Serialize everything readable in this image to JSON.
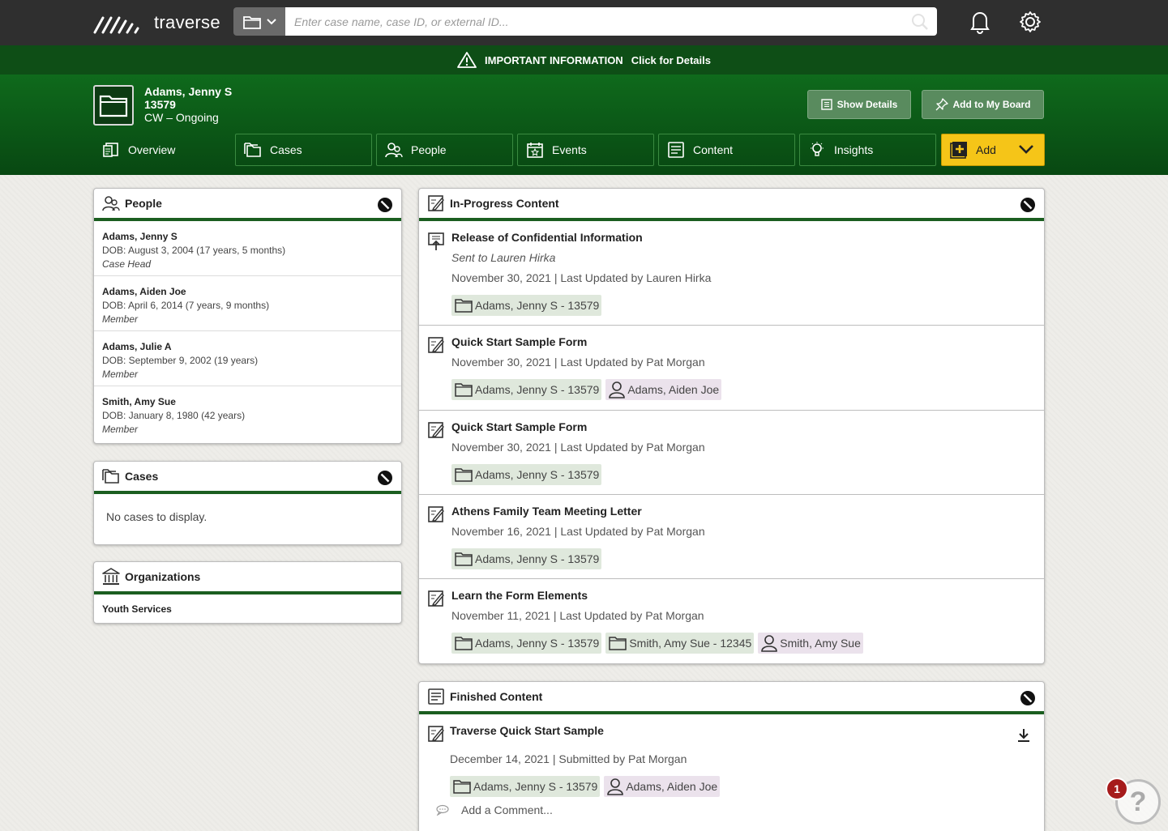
{
  "app": {
    "name": "traverse"
  },
  "search": {
    "placeholder": "Enter case name, case ID, or external ID..."
  },
  "infobar": {
    "title": "IMPORTANT INFORMATION",
    "link": "Click for Details"
  },
  "case": {
    "name": "Adams, Jenny S",
    "id": "13579",
    "type": "CW – Ongoing"
  },
  "header_buttons": {
    "show_details": "Show Details",
    "add_to_board": "Add to My Board"
  },
  "tabs": [
    {
      "label": "Overview",
      "icon": "overview-icon"
    },
    {
      "label": "Cases",
      "icon": "cases-icon"
    },
    {
      "label": "People",
      "icon": "people-icon"
    },
    {
      "label": "Events",
      "icon": "calendar-icon"
    },
    {
      "label": "Content",
      "icon": "content-icon"
    },
    {
      "label": "Insights",
      "icon": "lightbulb-icon"
    },
    {
      "label": "Add",
      "icon": "plus-icon"
    }
  ],
  "people_panel": {
    "title": "People",
    "people": [
      {
        "name": "Adams, Jenny S",
        "dob": "DOB: August 3, 2004 (17 years, 5 months)",
        "role": "Case Head"
      },
      {
        "name": "Adams, Aiden Joe",
        "dob": "DOB: April 6, 2014 (7 years, 9 months)",
        "role": "Member"
      },
      {
        "name": "Adams, Julie A",
        "dob": "DOB: September 9, 2002 (19 years)",
        "role": "Member"
      },
      {
        "name": "Smith, Amy Sue",
        "dob": "DOB: January 8, 1980 (42 years)",
        "role": "Member"
      }
    ]
  },
  "cases_panel": {
    "title": "Cases",
    "empty": "No cases to display."
  },
  "orgs_panel": {
    "title": "Organizations",
    "items": [
      "Youth Services"
    ]
  },
  "in_progress": {
    "title": "In-Progress Content",
    "items": [
      {
        "title": "Release of Confidential Information",
        "subtitle": "Sent to Lauren Hirka",
        "meta": "November 30, 2021  |  Last Updated by Lauren Hirka",
        "tags": [
          {
            "type": "case",
            "label": "Adams, Jenny S - 13579"
          }
        ]
      },
      {
        "title": "Quick Start Sample Form",
        "meta": "November 30, 2021  |  Last Updated by Pat Morgan",
        "tags": [
          {
            "type": "case",
            "label": "Adams, Jenny S - 13579"
          },
          {
            "type": "person",
            "label": "Adams, Aiden Joe"
          }
        ]
      },
      {
        "title": "Quick Start Sample Form",
        "meta": "November 30, 2021  |  Last Updated by Pat Morgan",
        "tags": [
          {
            "type": "case",
            "label": "Adams, Jenny S - 13579"
          }
        ]
      },
      {
        "title": "Athens Family Team Meeting Letter",
        "meta": "November 16, 2021  |  Last Updated by Pat Morgan",
        "tags": [
          {
            "type": "case",
            "label": "Adams, Jenny S - 13579"
          }
        ]
      },
      {
        "title": "Learn the Form Elements",
        "meta": "November 11, 2021  |  Last Updated by Pat Morgan",
        "tags": [
          {
            "type": "case",
            "label": "Adams, Jenny S - 13579"
          },
          {
            "type": "case",
            "label": "Smith, Amy Sue - 12345"
          },
          {
            "type": "person",
            "label": "Smith, Amy Sue"
          }
        ]
      }
    ]
  },
  "finished": {
    "title": "Finished Content",
    "items": [
      {
        "title": "Traverse Quick Start Sample",
        "meta": "December 14, 2021  |  Submitted by Pat Morgan",
        "tags": [
          {
            "type": "case",
            "label": "Adams, Jenny S - 13579"
          },
          {
            "type": "person",
            "label": "Adams, Aiden Joe"
          }
        ],
        "comment": "Add a Comment..."
      }
    ]
  },
  "help": {
    "badge": "1",
    "symbol": "?"
  },
  "colors": {
    "topbar": "#2f2f2f",
    "green_dark": "#0e4e16",
    "accent_yellow": "#f5c518",
    "case_tag": "#dfe8dc",
    "person_tag": "#ebe2ec"
  }
}
